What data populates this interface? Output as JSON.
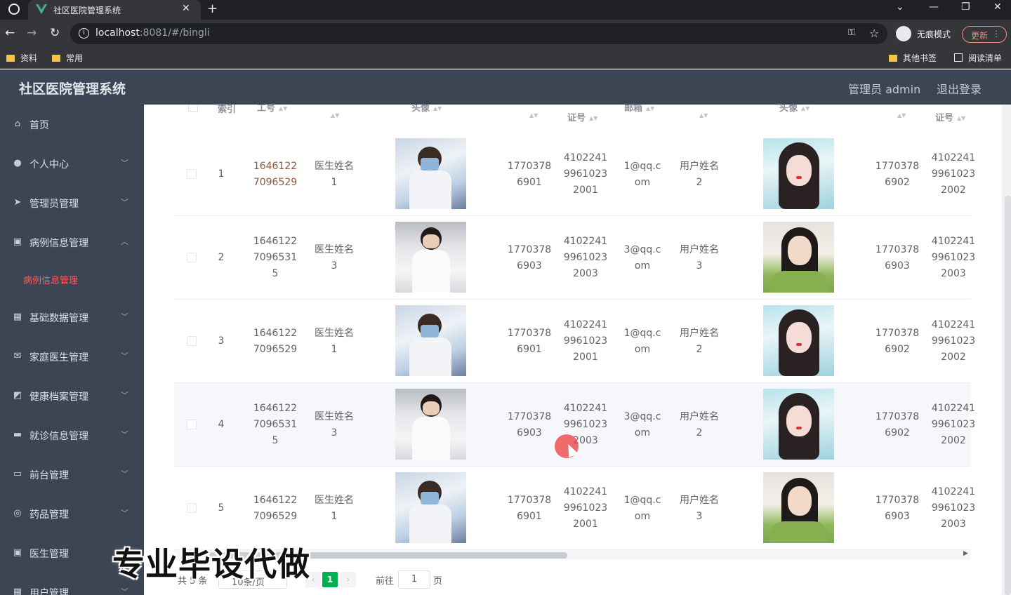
{
  "browser": {
    "tab_title": "社区医院管理系统",
    "tab_close": "✕",
    "new_tab": "+",
    "url_host": "localhost",
    "url_rest": ":8081/#/bingli",
    "incognito_label": "无痕模式",
    "update_label": "更新",
    "bookmarks": [
      "资料",
      "常用"
    ],
    "other_bookmarks": "其他书签",
    "reading_list": "阅读清单"
  },
  "header": {
    "title": "社区医院管理系统",
    "admin_label": "管理员 admin",
    "logout_label": "退出登录"
  },
  "sidebar": {
    "items": [
      {
        "label": "首页",
        "icon": "home-icon"
      },
      {
        "label": "个人中心",
        "icon": "user-icon"
      },
      {
        "label": "管理员管理",
        "icon": "send-icon"
      },
      {
        "label": "病例信息管理",
        "icon": "clipboard-icon"
      },
      {
        "label": "基础数据管理",
        "icon": "grid-icon"
      },
      {
        "label": "家庭医生管理",
        "icon": "mail-icon"
      },
      {
        "label": "健康档案管理",
        "icon": "chart-icon"
      },
      {
        "label": "就诊信息管理",
        "icon": "monitor-icon"
      },
      {
        "label": "前台管理",
        "icon": "window-icon"
      },
      {
        "label": "药品管理",
        "icon": "compass-icon"
      },
      {
        "label": "医生管理",
        "icon": "clipboard-check-icon"
      },
      {
        "label": "用户管理",
        "icon": "grid-icon"
      }
    ],
    "active_submenu": "病例信息管理"
  },
  "table": {
    "headers": [
      "索引",
      "工号",
      "",
      "头像",
      "",
      "证号",
      "邮箱",
      "",
      "头像",
      "",
      "证号"
    ],
    "rows": [
      {
        "index": "1",
        "worker_no": [
          "1646122",
          "7096529"
        ],
        "doctor_name": [
          "医生姓名",
          "1"
        ],
        "doctor_photo": "doctor1",
        "doctor_phone": [
          "1770378",
          "6901"
        ],
        "doctor_id": [
          "4102241",
          "9961023",
          "2001"
        ],
        "email": [
          "1@qq.c",
          "om"
        ],
        "user_name": [
          "用户姓名",
          "2"
        ],
        "user_photo": "girl1",
        "user_phone": [
          "1770378",
          "6902"
        ],
        "user_id": [
          "4102241",
          "9961023",
          "2002"
        ]
      },
      {
        "index": "2",
        "worker_no": [
          "1646122",
          "7096531",
          "5"
        ],
        "doctor_name": [
          "医生姓名",
          "3"
        ],
        "doctor_photo": "doctor2",
        "doctor_phone": [
          "1770378",
          "6903"
        ],
        "doctor_id": [
          "4102241",
          "9961023",
          "2003"
        ],
        "email": [
          "3@qq.c",
          "om"
        ],
        "user_name": [
          "用户姓名",
          "3"
        ],
        "user_photo": "girl2",
        "user_phone": [
          "1770378",
          "6903"
        ],
        "user_id": [
          "4102241",
          "9961023",
          "2003"
        ]
      },
      {
        "index": "3",
        "worker_no": [
          "1646122",
          "7096529"
        ],
        "doctor_name": [
          "医生姓名",
          "1"
        ],
        "doctor_photo": "doctor1",
        "doctor_phone": [
          "1770378",
          "6901"
        ],
        "doctor_id": [
          "4102241",
          "9961023",
          "2001"
        ],
        "email": [
          "1@qq.c",
          "om"
        ],
        "user_name": [
          "用户姓名",
          "2"
        ],
        "user_photo": "girl1",
        "user_phone": [
          "1770378",
          "6902"
        ],
        "user_id": [
          "4102241",
          "9961023",
          "2002"
        ]
      },
      {
        "index": "4",
        "worker_no": [
          "1646122",
          "7096531",
          "5"
        ],
        "doctor_name": [
          "医生姓名",
          "3"
        ],
        "doctor_photo": "doctor2",
        "doctor_phone": [
          "1770378",
          "6903"
        ],
        "doctor_id": [
          "4102241",
          "9961023",
          "2003"
        ],
        "email": [
          "3@qq.c",
          "om"
        ],
        "user_name": [
          "用户姓名",
          "2"
        ],
        "user_photo": "girl1",
        "user_phone": [
          "1770378",
          "6902"
        ],
        "user_id": [
          "4102241",
          "9961023",
          "2002"
        ]
      },
      {
        "index": "5",
        "worker_no": [
          "1646122",
          "7096529"
        ],
        "doctor_name": [
          "医生姓名",
          "1"
        ],
        "doctor_photo": "doctor1",
        "doctor_phone": [
          "1770378",
          "6901"
        ],
        "doctor_id": [
          "4102241",
          "9961023",
          "2001"
        ],
        "email": [
          "1@qq.c",
          "om"
        ],
        "user_name": [
          "用户姓名",
          "3"
        ],
        "user_photo": "girl2",
        "user_phone": [
          "1770378",
          "6903"
        ],
        "user_id": [
          "4102241",
          "9961023",
          "2003"
        ]
      }
    ]
  },
  "pagination": {
    "total": "共 5 条",
    "page_size": "10条/页",
    "current_page": "1",
    "goto_label": "前往",
    "goto_value": "1",
    "page_suffix": "页"
  },
  "overlay": {
    "watermark": "专业毕设代做"
  },
  "colors": {
    "sidebar_bg": "#3c4554",
    "active_submenu": "#ff5c5c",
    "pager_active": "#00b050"
  }
}
